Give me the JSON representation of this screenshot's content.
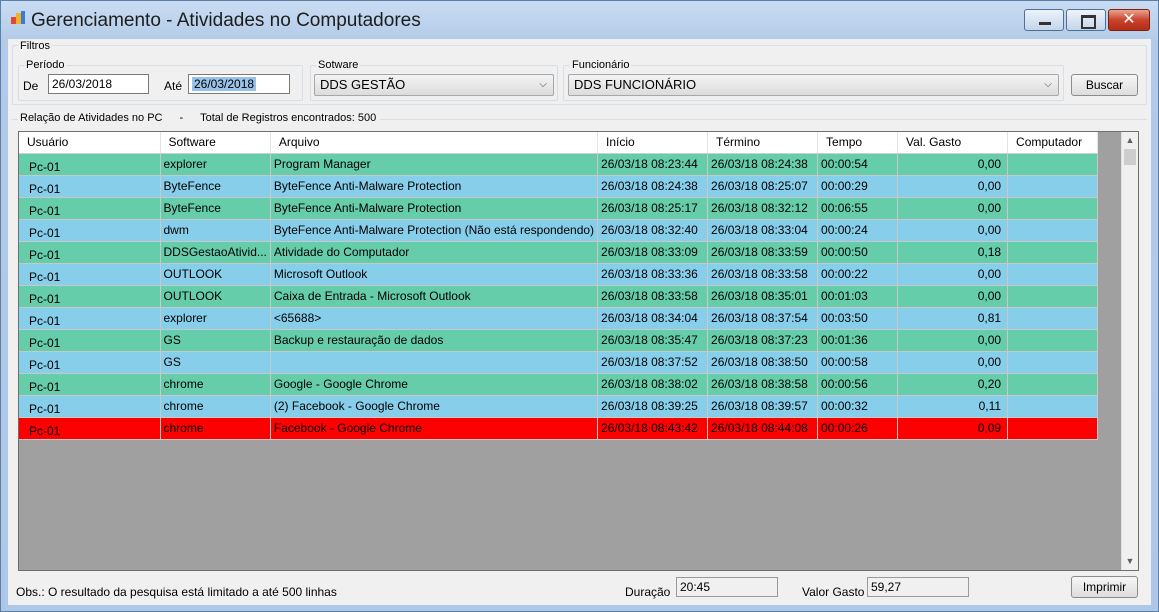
{
  "window": {
    "title": "Gerenciamento - Atividades no Computadores",
    "close_glyph": "✕"
  },
  "filters": {
    "group_label": "Filtros",
    "period": {
      "label": "Período",
      "from_label": "De",
      "from_value": "26/03/2018",
      "to_label": "Até",
      "to_value": "26/03/2018"
    },
    "software": {
      "label": "Sotware",
      "selected": "DDS GESTÃO"
    },
    "employee": {
      "label": "Funcionário",
      "selected": "DDS FUNCIONÁRIO"
    },
    "search_button": "Buscar"
  },
  "results": {
    "title": "Relação de Atividades no PC",
    "separator": "-",
    "total_text": "Total de Registros encontrados: 500"
  },
  "grid": {
    "columns": [
      "Usuário",
      "Software",
      "Arquivo",
      "Início",
      "Término",
      "Tempo",
      "Val. Gasto",
      "Computador"
    ],
    "colors": {
      "green": "#66cdaa",
      "blue": "#87ceeb",
      "red": "#ff0000"
    },
    "rows": [
      {
        "color": "green",
        "cells": [
          "Pc-01",
          "explorer",
          "Program Manager",
          "26/03/18 08:23:44",
          "26/03/18 08:24:38",
          "00:00:54",
          "0,00",
          ""
        ]
      },
      {
        "color": "blue",
        "cells": [
          "Pc-01",
          "ByteFence",
          "ByteFence Anti-Malware Protection",
          "26/03/18 08:24:38",
          "26/03/18 08:25:07",
          "00:00:29",
          "0,00",
          ""
        ]
      },
      {
        "color": "green",
        "cells": [
          "Pc-01",
          "ByteFence",
          "ByteFence Anti-Malware Protection",
          "26/03/18 08:25:17",
          "26/03/18 08:32:12",
          "00:06:55",
          "0,00",
          ""
        ]
      },
      {
        "color": "blue",
        "cells": [
          "Pc-01",
          "dwm",
          "ByteFence Anti-Malware Protection (Não está respondendo)",
          "26/03/18 08:32:40",
          "26/03/18 08:33:04",
          "00:00:24",
          "0,00",
          ""
        ]
      },
      {
        "color": "green",
        "cells": [
          "Pc-01",
          "DDSGestaoAtivid...",
          "Atividade do Computador",
          "26/03/18 08:33:09",
          "26/03/18 08:33:59",
          "00:00:50",
          "0,18",
          ""
        ]
      },
      {
        "color": "blue",
        "cells": [
          "Pc-01",
          "OUTLOOK",
          "Microsoft Outlook",
          "26/03/18 08:33:36",
          "26/03/18 08:33:58",
          "00:00:22",
          "0,00",
          ""
        ]
      },
      {
        "color": "green",
        "cells": [
          "Pc-01",
          "OUTLOOK",
          "Caixa de Entrada - Microsoft Outlook",
          "26/03/18 08:33:58",
          "26/03/18 08:35:01",
          "00:01:03",
          "0,00",
          ""
        ]
      },
      {
        "color": "blue",
        "cells": [
          "Pc-01",
          "explorer",
          "<65688>",
          "26/03/18 08:34:04",
          "26/03/18 08:37:54",
          "00:03:50",
          "0,81",
          ""
        ]
      },
      {
        "color": "green",
        "cells": [
          "Pc-01",
          "GS",
          "Backup e restauração de dados",
          "26/03/18 08:35:47",
          "26/03/18 08:37:23",
          "00:01:36",
          "0,00",
          ""
        ]
      },
      {
        "color": "blue",
        "cells": [
          "Pc-01",
          "GS",
          "",
          "26/03/18 08:37:52",
          "26/03/18 08:38:50",
          "00:00:58",
          "0,00",
          ""
        ]
      },
      {
        "color": "green",
        "cells": [
          "Pc-01",
          "chrome",
          "Google - Google Chrome",
          "26/03/18 08:38:02",
          "26/03/18 08:38:58",
          "00:00:56",
          "0,20",
          ""
        ]
      },
      {
        "color": "blue",
        "cells": [
          "Pc-01",
          "chrome",
          "(2) Facebook - Google Chrome",
          "26/03/18 08:39:25",
          "26/03/18 08:39:57",
          "00:00:32",
          "0,11",
          ""
        ]
      },
      {
        "color": "red",
        "cells": [
          "Pc-01",
          "chrome",
          "Facebook - Google Chrome",
          "26/03/18 08:43:42",
          "26/03/18 08:44:08",
          "00:00:26",
          "0,09",
          ""
        ]
      }
    ]
  },
  "footer": {
    "note": "Obs.: O resultado da pesquisa está limitado a até 500 linhas",
    "duration_label": "Duração",
    "duration_value": "20:45",
    "value_label": "Valor Gasto",
    "value_value": "59,27",
    "print_button": "Imprimir"
  }
}
